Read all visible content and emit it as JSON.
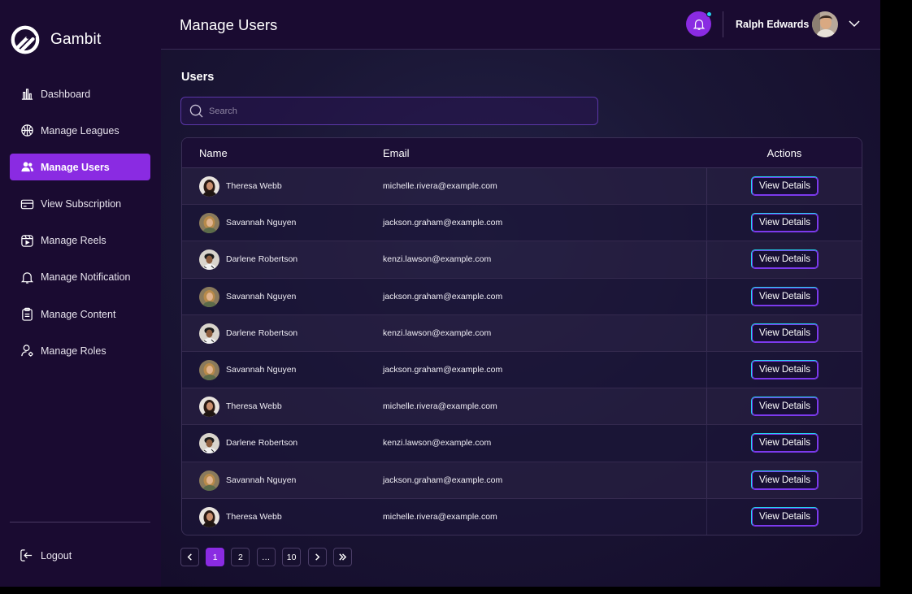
{
  "brand": {
    "name": "Gambit"
  },
  "sidebar": {
    "items": [
      {
        "label": "Dashboard",
        "icon": "bar-chart-icon",
        "active": false
      },
      {
        "label": "Manage Leagues",
        "icon": "basketball-icon",
        "active": false
      },
      {
        "label": "Manage Users",
        "icon": "users-icon",
        "active": true
      },
      {
        "label": "View Subscription",
        "icon": "card-icon",
        "active": false
      },
      {
        "label": "Manage Reels",
        "icon": "reels-icon",
        "active": false
      },
      {
        "label": "Manage Notification",
        "icon": "bell-icon",
        "active": false
      },
      {
        "label": "Manage Content",
        "icon": "clipboard-icon",
        "active": false
      },
      {
        "label": "Manage Roles",
        "icon": "user-cog-icon",
        "active": false
      }
    ],
    "logout_label": "Logout"
  },
  "header": {
    "title": "Manage Users",
    "user_name": "Ralph Edwards"
  },
  "main": {
    "section_title": "Users",
    "search_placeholder": "Search"
  },
  "table": {
    "columns": [
      "Name",
      "Email",
      "Actions"
    ],
    "rows": [
      {
        "name": "Theresa Webb",
        "email": "michelle.rivera@example.com",
        "action": "View Details",
        "avatar": "a"
      },
      {
        "name": "Savannah Nguyen",
        "email": "jackson.graham@example.com",
        "action": "View Details",
        "avatar": "b"
      },
      {
        "name": "Darlene Robertson",
        "email": "kenzi.lawson@example.com",
        "action": "View Details",
        "avatar": "c"
      },
      {
        "name": "Savannah Nguyen",
        "email": "jackson.graham@example.com",
        "action": "View Details",
        "avatar": "b"
      },
      {
        "name": "Darlene Robertson",
        "email": "kenzi.lawson@example.com",
        "action": "View Details",
        "avatar": "c"
      },
      {
        "name": "Savannah Nguyen",
        "email": "jackson.graham@example.com",
        "action": "View Details",
        "avatar": "b"
      },
      {
        "name": "Theresa Webb",
        "email": "michelle.rivera@example.com",
        "action": "View Details",
        "avatar": "a"
      },
      {
        "name": "Darlene Robertson",
        "email": "kenzi.lawson@example.com",
        "action": "View Details",
        "avatar": "c"
      },
      {
        "name": "Savannah Nguyen",
        "email": "jackson.graham@example.com",
        "action": "View Details",
        "avatar": "b"
      },
      {
        "name": "Theresa Webb",
        "email": "michelle.rivera@example.com",
        "action": "View Details",
        "avatar": "a"
      }
    ]
  },
  "pagination": {
    "pages": [
      "1",
      "2",
      "…",
      "10"
    ],
    "current": "1"
  },
  "colors": {
    "accent": "#8a2be2",
    "notification_dot": "#22d3ee",
    "sidebar_bg": "#1a0b31"
  }
}
